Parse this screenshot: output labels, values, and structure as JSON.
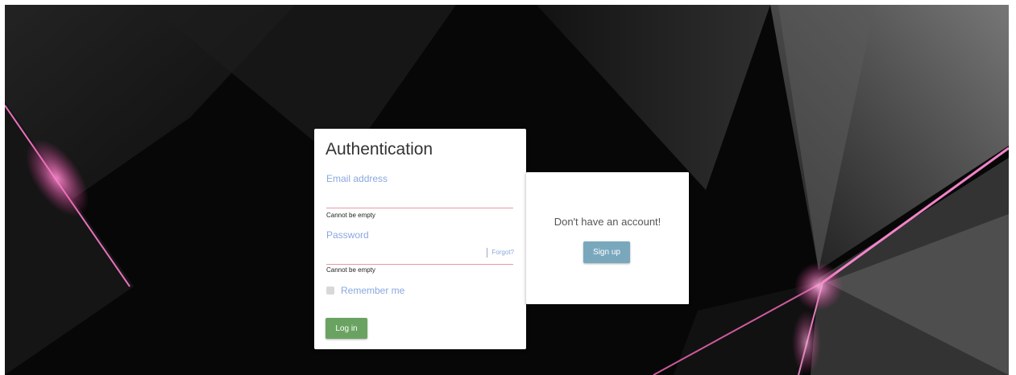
{
  "background": {
    "base_color": "#0a0a0a",
    "accent_glow_color": "#e03b9a"
  },
  "login": {
    "title": "Authentication",
    "email": {
      "label": "Email address",
      "value": "",
      "error": "Cannot be empty"
    },
    "password": {
      "label": "Password",
      "value": "",
      "error": "Cannot be empty",
      "forgot_label": "Forgot?"
    },
    "remember": {
      "label": "Remember me",
      "checked": false
    },
    "submit_label": "Log in",
    "submit_color": "#6aa361"
  },
  "signup": {
    "prompt": "Don't have an account!",
    "button_label": "Sign up",
    "button_color": "#79a8bd"
  }
}
